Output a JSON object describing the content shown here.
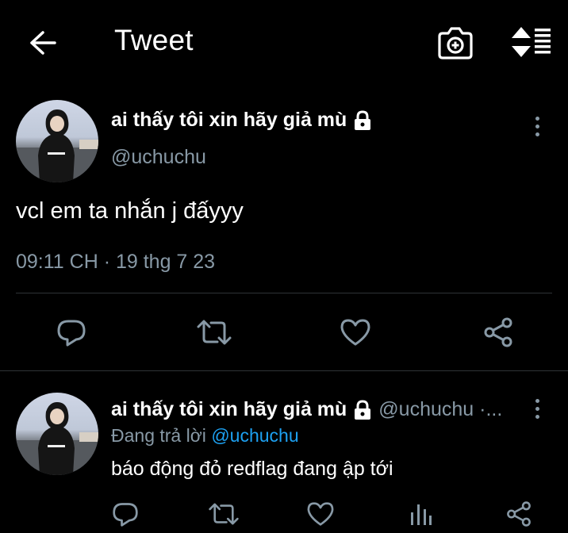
{
  "header": {
    "title": "Tweet",
    "icons": {
      "back": "arrow-left-icon",
      "camera": "camera-plus-icon",
      "sort": "sort-icon"
    }
  },
  "tweet": {
    "display_name": "ai thấy tôi xin hãy giả mù",
    "handle": "@uchuchu",
    "text": "vcl em ta nhắn j đấyyy",
    "timestamp": "09:11 CH · 19 thg 7 23",
    "actions": [
      "reply-icon",
      "retweet-icon",
      "like-icon",
      "share-icon"
    ]
  },
  "reply": {
    "display_name": "ai thấy tôi xin hãy giả mù",
    "handle_time": "@uchuchu ·...",
    "replying_prefix": "Đang trả lời",
    "replying_to": "@uchuchu",
    "text": "báo động đỏ redflag đang ập tới",
    "actions": [
      "reply-icon",
      "retweet-icon",
      "like-icon",
      "analytics-icon",
      "share-icon"
    ]
  },
  "colors": {
    "background": "#000000",
    "secondary_text": "#8899a6",
    "accent": "#1da1f2",
    "divider": "#2f3336"
  }
}
